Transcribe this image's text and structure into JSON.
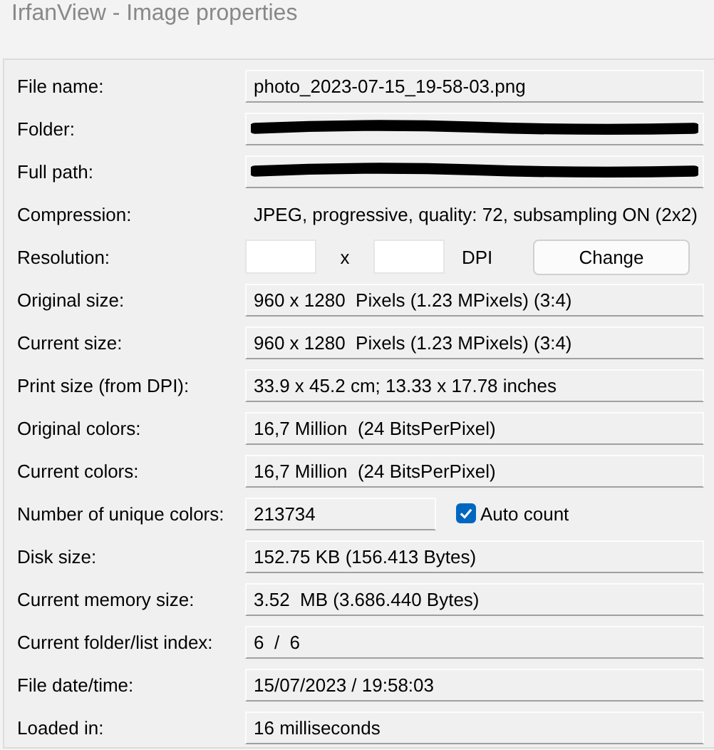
{
  "window": {
    "title": "IrfanView - Image properties"
  },
  "rows": [
    {
      "kind": "text",
      "label": "File name:",
      "value": "photo_2023-07-15_19-58-03.png"
    },
    {
      "kind": "redacted",
      "label": "Folder:"
    },
    {
      "kind": "redacted",
      "label": "Full path:"
    },
    {
      "kind": "plain",
      "label": "Compression:",
      "value": "JPEG, progressive, quality: 72, subsampling ON (2x2)"
    },
    {
      "kind": "resolution",
      "label": "Resolution:",
      "separator": "x",
      "unit": "DPI",
      "button": "Change"
    },
    {
      "kind": "text",
      "label": "Original size:",
      "value": "960 x 1280  Pixels (1.23 MPixels) (3:4)"
    },
    {
      "kind": "text",
      "label": "Current size:",
      "value": "960 x 1280  Pixels (1.23 MPixels) (3:4)"
    },
    {
      "kind": "text",
      "label": "Print size (from DPI):",
      "value": "33.9 x 45.2 cm; 13.33 x 17.78 inches"
    },
    {
      "kind": "text",
      "label": "Original colors:",
      "value": "16,7 Million  (24 BitsPerPixel)"
    },
    {
      "kind": "text",
      "label": "Current colors:",
      "value": "16,7 Million  (24 BitsPerPixel)"
    },
    {
      "kind": "count",
      "label": "Number of unique colors:",
      "value": "213734",
      "checkbox": {
        "label": "Auto count",
        "checked": true
      }
    },
    {
      "kind": "text",
      "label": "Disk size:",
      "value": "152.75 KB (156.413 Bytes)"
    },
    {
      "kind": "text",
      "label": "Current memory size:",
      "value": "3.52  MB (3.686.440 Bytes)"
    },
    {
      "kind": "text",
      "label": "Current folder/list index:",
      "value": "6  /  6"
    },
    {
      "kind": "text",
      "label": "File date/time:",
      "value": "15/07/2023 / 19:58:03"
    },
    {
      "kind": "text",
      "label": "Loaded in:",
      "value": "16 milliseconds"
    }
  ]
}
